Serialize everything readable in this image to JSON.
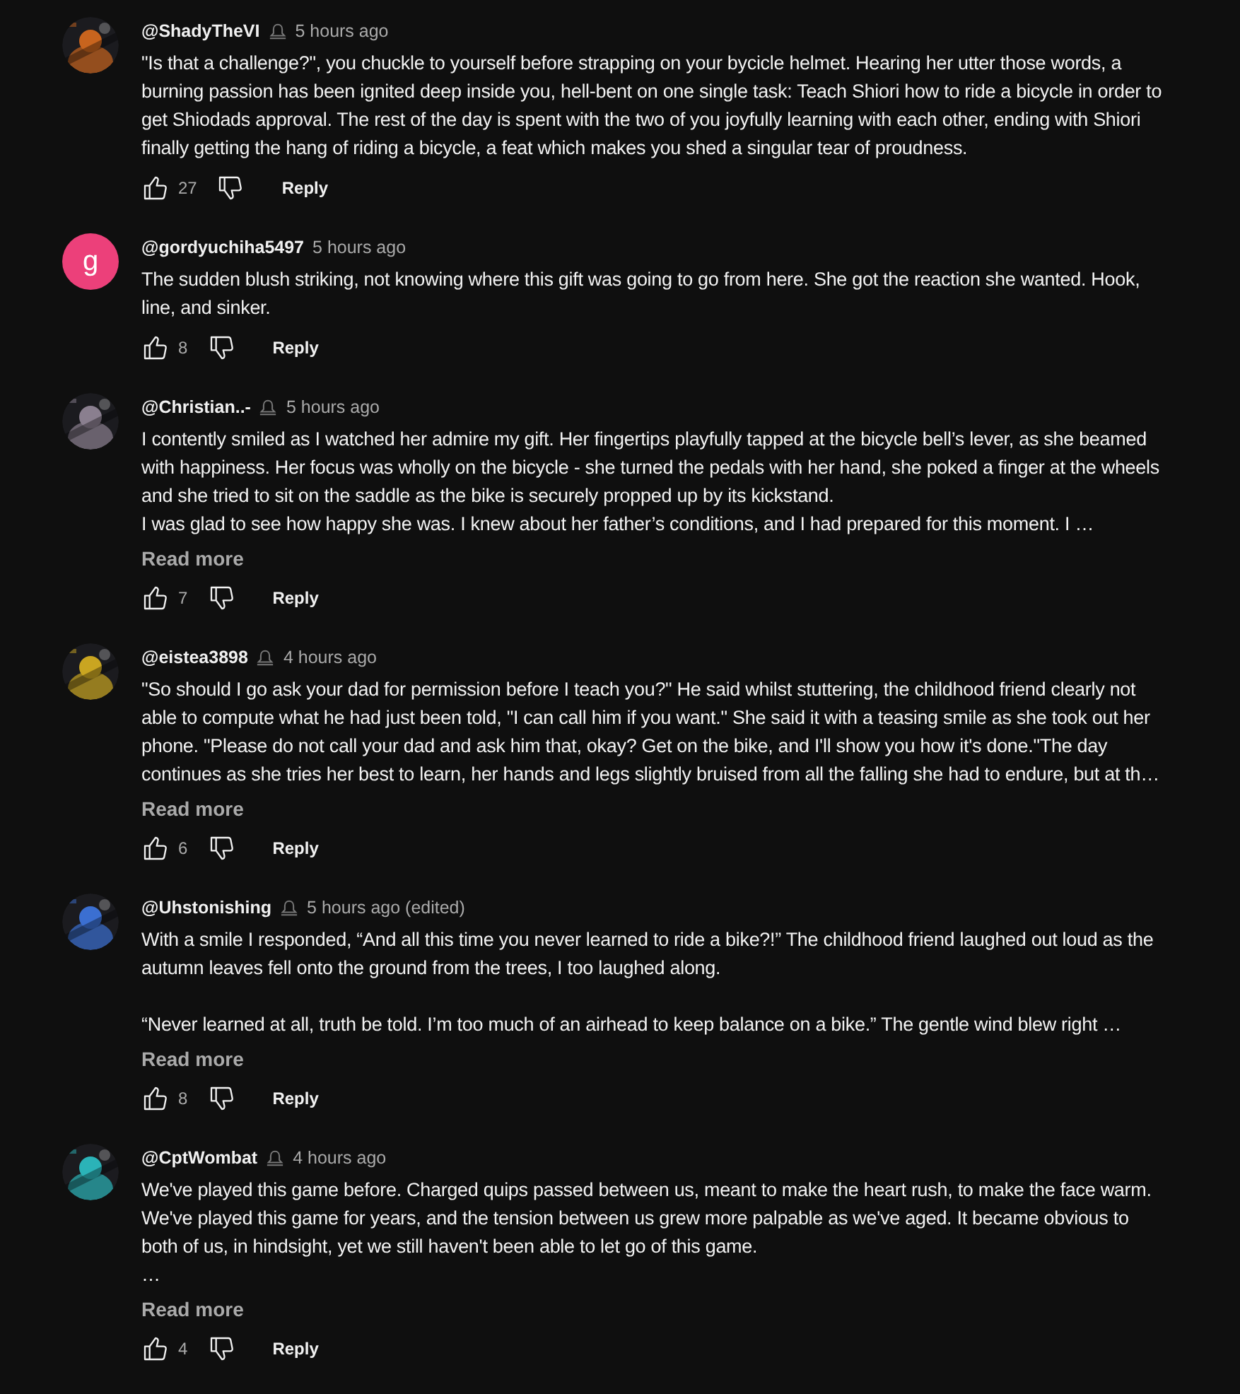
{
  "comments": [
    {
      "avatar": {
        "kind": "picture"
      },
      "author": "@ShadyTheVI",
      "badge": true,
      "time": "5 hours ago",
      "paragraphs": [
        [
          "\"Is that a challenge?\", you chuckle to yourself before strapping on your bycicle helmet. Hearing her utter those words, a",
          "burning passion has been ignited deep inside you, hell-bent on one single task: Teach Shiori how to ride a bicycle in order to",
          "get Shiodads approval. The rest of the day is spent with the two of you joyfully learning with each other, ending with Shiori",
          "finally getting the hang of riding a bicycle, a feat which makes you shed a singular tear of proudness."
        ]
      ],
      "likes": "27",
      "reply": "Reply"
    },
    {
      "avatar": {
        "kind": "letter",
        "letter": "g",
        "color": "#ec407a"
      },
      "author": "@gordyuchiha5497",
      "badge": false,
      "time": "5 hours ago",
      "paragraphs": [
        [
          "The sudden blush striking, not knowing where this gift was going to go from here. She got the reaction she wanted. Hook,",
          "line, and sinker."
        ]
      ],
      "likes": "8",
      "reply": "Reply"
    },
    {
      "avatar": {
        "kind": "picture"
      },
      "author": "@Christian..-",
      "badge": true,
      "time": "5 hours ago",
      "paragraphs": [
        [
          "I contently smiled as I watched her admire my gift. Her fingertips playfully tapped at the bicycle bell’s lever, as she beamed",
          "with happiness. Her focus was wholly on the bicycle - she turned the pedals with her hand, she poked a finger at the wheels",
          "and she tried to sit on the saddle as the bike is securely propped up by its kickstand.",
          "I was glad to see how happy she was. I knew about her father’s conditions, and I had prepared for this moment. I …"
        ]
      ],
      "read_more": "Read more",
      "likes": "7",
      "reply": "Reply"
    },
    {
      "avatar": {
        "kind": "picture"
      },
      "author": "@eistea3898",
      "badge": true,
      "time": "4 hours ago",
      "paragraphs": [
        [
          "\"So should I go ask your dad for permission before I teach you?\" He said whilst stuttering, the childhood friend clearly not",
          "able to compute what he had just been told, \"I can call him if you want.\" She said it with a teasing smile as she took out her",
          "phone. \"Please do not call your dad and ask him that, okay? Get on the bike, and I'll show you how it's done.\"The day",
          "continues as she tries her best to learn, her hands and legs slightly bruised from all the falling she had to endure, but at th…"
        ]
      ],
      "read_more": "Read more",
      "likes": "6",
      "reply": "Reply"
    },
    {
      "avatar": {
        "kind": "picture"
      },
      "author": "@Uhstonishing",
      "badge": true,
      "time": "5 hours ago (edited)",
      "paragraphs": [
        [
          "With a smile I responded, “And all this time you never learned to ride a bike?!” The childhood friend laughed out loud as the",
          "autumn leaves fell onto the ground from the trees, I too laughed along."
        ],
        [
          "“Never learned at all, truth be told. I’m too much of an airhead to keep balance on a bike.” The gentle wind blew right …"
        ]
      ],
      "read_more": "Read more",
      "likes": "8",
      "reply": "Reply"
    },
    {
      "avatar": {
        "kind": "picture"
      },
      "author": "@CptWombat",
      "badge": true,
      "time": "4 hours ago",
      "paragraphs": [
        [
          "We've played this game before. Charged quips passed between us, meant to make the heart rush, to make the face warm.",
          "We've played this game for years, and the tension between us grew more palpable as we've aged. It became obvious to",
          "both of us, in hindsight, yet we still haven't been able to let go of this game.",
          "…"
        ]
      ],
      "read_more": "Read more",
      "likes": "4",
      "reply": "Reply"
    }
  ]
}
